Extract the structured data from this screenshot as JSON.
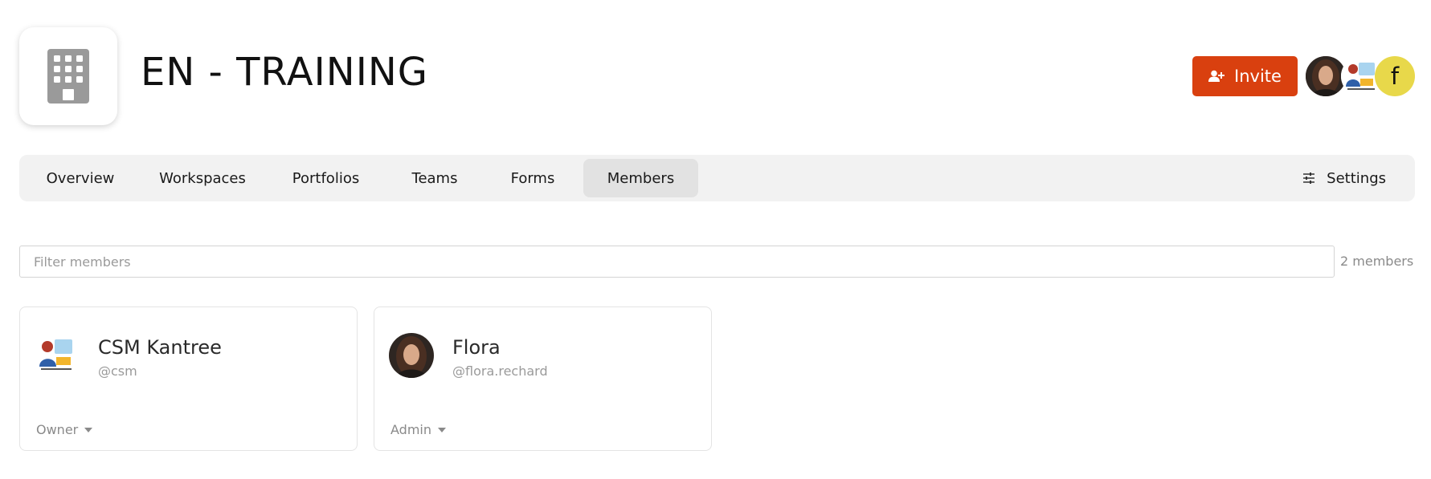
{
  "org": {
    "title": "EN - TRAINING",
    "logo_icon": "building-icon"
  },
  "header": {
    "invite_label": "Invite",
    "invite_icon": "user-plus-icon",
    "accent_color": "#d9400f",
    "avatars": [
      {
        "name": "Flora",
        "type": "photo"
      },
      {
        "name": "CSM Kantree",
        "type": "illustration"
      },
      {
        "initial": "f",
        "color": "#e8d84a"
      }
    ]
  },
  "nav": {
    "tabs": [
      {
        "label": "Overview",
        "active": false
      },
      {
        "label": "Workspaces",
        "active": false
      },
      {
        "label": "Portfolios",
        "active": false
      },
      {
        "label": "Teams",
        "active": false
      },
      {
        "label": "Forms",
        "active": false
      },
      {
        "label": "Members",
        "active": true
      }
    ],
    "settings_label": "Settings",
    "settings_icon": "sliders-icon"
  },
  "filter": {
    "placeholder": "Filter members",
    "value": "",
    "count_label": "2 members"
  },
  "members": [
    {
      "name": "CSM Kantree",
      "handle": "@csm",
      "role": "Owner",
      "avatar": "customer-support-illustration"
    },
    {
      "name": "Flora",
      "handle": "@flora.rechard",
      "role": "Admin",
      "avatar": "photo"
    }
  ]
}
